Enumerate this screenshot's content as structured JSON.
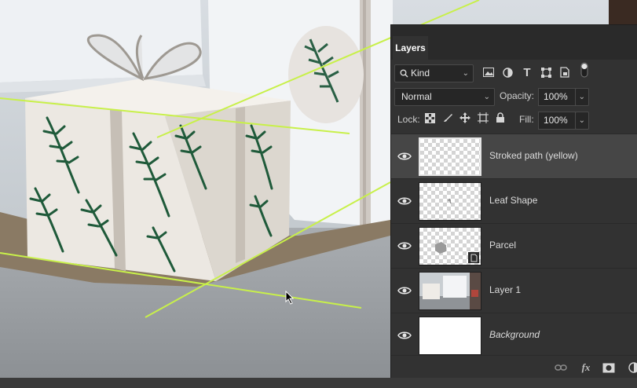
{
  "panel": {
    "tab_label": "Layers",
    "filter_kind": "Kind",
    "blend_mode": "Normal",
    "opacity_label": "Opacity:",
    "opacity_value": "100%",
    "lock_label": "Lock:",
    "fill_label": "Fill:",
    "fill_value": "100%",
    "filter_icons": [
      "image-filter-icon",
      "adjustment-filter-icon",
      "type-filter-icon",
      "shape-filter-icon",
      "smart-object-filter-icon",
      "filter-toggle-icon"
    ],
    "lock_icons": [
      "lock-transparent-pixels-icon",
      "lock-image-pixels-icon",
      "lock-position-icon",
      "lock-artboard-icon",
      "lock-all-icon"
    ],
    "bottom_icons": [
      "link-layers-icon",
      "layer-style-fx-icon",
      "add-mask-icon",
      "new-adjustment-layer-icon"
    ],
    "fx_label": "fx"
  },
  "layers": [
    {
      "name": "Stroked path (yellow)",
      "visible": true,
      "selected": true,
      "thumb": "transparent"
    },
    {
      "name": "Leaf Shape",
      "visible": true,
      "selected": false,
      "thumb": "transparent-leaf"
    },
    {
      "name": "Parcel",
      "visible": true,
      "selected": false,
      "thumb": "transparent-parcel-smart"
    },
    {
      "name": "Layer 1",
      "visible": true,
      "selected": false,
      "thumb": "photo"
    },
    {
      "name": "Background",
      "visible": true,
      "selected": false,
      "thumb": "white"
    }
  ],
  "colors": {
    "path_stroke": "#c8f04a",
    "leaf_green": "#1f5a3a",
    "panel_bg": "#323232",
    "selected_row": "#464646"
  }
}
